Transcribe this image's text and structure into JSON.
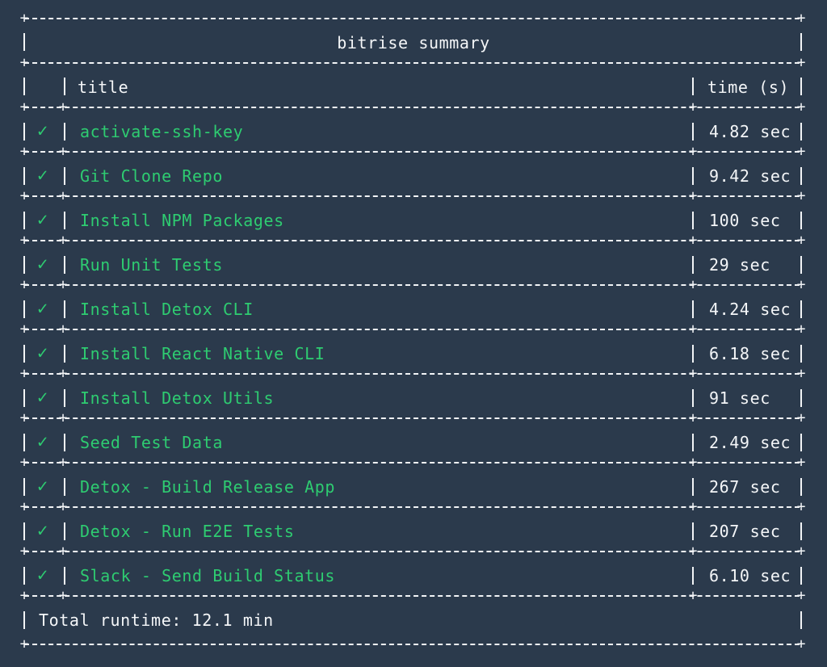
{
  "summary": {
    "title": "bitrise summary",
    "col_title": "title",
    "col_time": "time (s)",
    "status_icon": "✓",
    "steps": [
      {
        "name": "activate-ssh-key",
        "time": "4.82 sec",
        "status": "success"
      },
      {
        "name": "Git Clone Repo",
        "time": "9.42 sec",
        "status": "success"
      },
      {
        "name": "Install NPM Packages",
        "time": "100 sec",
        "status": "success"
      },
      {
        "name": "Run Unit Tests",
        "time": "29 sec",
        "status": "success"
      },
      {
        "name": "Install Detox CLI",
        "time": "4.24 sec",
        "status": "success"
      },
      {
        "name": "Install React Native CLI",
        "time": "6.18 sec",
        "status": "success"
      },
      {
        "name": "Install Detox Utils",
        "time": "91 sec",
        "status": "success"
      },
      {
        "name": "Seed Test Data",
        "time": "2.49 sec",
        "status": "success"
      },
      {
        "name": "Detox - Build Release App",
        "time": "267 sec",
        "status": "success"
      },
      {
        "name": "Detox - Run E2E Tests",
        "time": "207 sec",
        "status": "success"
      },
      {
        "name": "Slack - Send Build Status",
        "time": "6.10 sec",
        "status": "success"
      }
    ],
    "total": "Total runtime: 12.1 min"
  },
  "colors": {
    "background": "#2b3a4c",
    "text": "#f4f6f8",
    "success": "#2ecc71"
  }
}
